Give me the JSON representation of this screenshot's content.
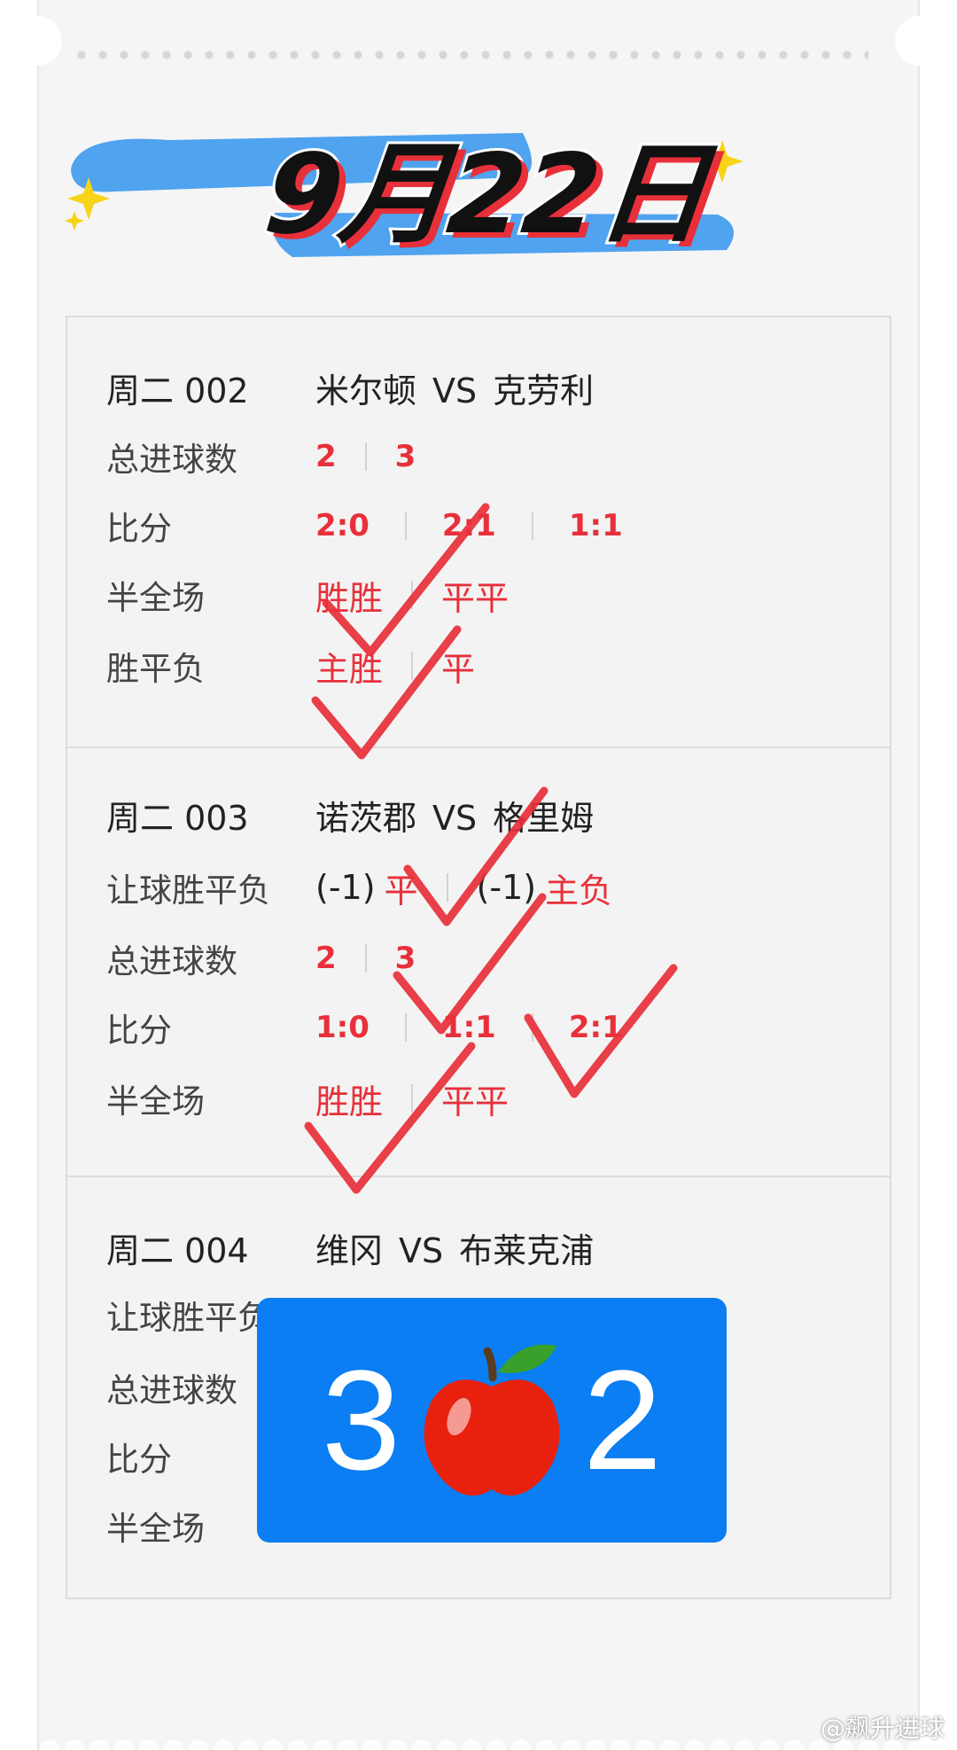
{
  "header": {
    "date_title": "9月22日"
  },
  "matches": [
    {
      "code": "周二 002",
      "home": "米尔顿",
      "vs": "VS",
      "away": "克劳利",
      "rows": [
        {
          "label": "总进球数",
          "values": [
            "2",
            "3"
          ]
        },
        {
          "label": "比分",
          "values": [
            "2:0",
            "2:1",
            "1:1"
          ]
        },
        {
          "label": "半全场",
          "values": [
            "胜胜",
            "平平"
          ]
        },
        {
          "label": "胜平负",
          "values": [
            "主胜",
            "平"
          ]
        }
      ]
    },
    {
      "code": "周二 003",
      "home": "诺茨郡",
      "vs": "VS",
      "away": "格里姆",
      "rows": [
        {
          "label": "让球胜平负",
          "handicap": [
            "(-1)",
            "(-1)"
          ],
          "values": [
            "平",
            "主负"
          ]
        },
        {
          "label": "总进球数",
          "values": [
            "2",
            "3"
          ]
        },
        {
          "label": "比分",
          "values": [
            "1:0",
            "1:1",
            "2:1"
          ]
        },
        {
          "label": "半全场",
          "values": [
            "胜胜",
            "平平"
          ]
        }
      ]
    },
    {
      "code": "周二 004",
      "home": "维冈",
      "vs": "VS",
      "away": "布莱克浦",
      "rows": [
        {
          "label": "让球胜平负"
        },
        {
          "label": "总进球数"
        },
        {
          "label": "比分"
        },
        {
          "label": "半全场"
        }
      ]
    }
  ],
  "score_badge": {
    "left": "3",
    "right": "2",
    "icon": "red-apple-icon"
  },
  "watermark": "@飙升进球",
  "colors": {
    "accent_red": "#e8303a",
    "badge_blue": "#0a7ef2",
    "highlight_blue": "#4fa3ef",
    "sparkle": "#f7d417"
  }
}
